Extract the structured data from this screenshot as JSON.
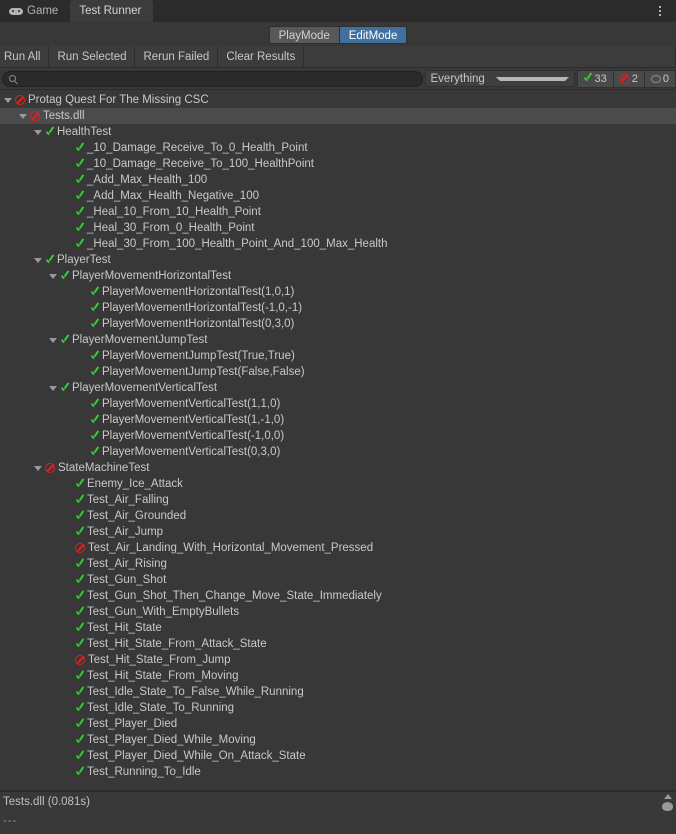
{
  "window": {
    "tabs": [
      {
        "label": "Game",
        "icon": "gamepad-icon",
        "active": false
      },
      {
        "label": "Test Runner",
        "icon": "",
        "active": true
      }
    ],
    "menu_icon": "kebab-menu-icon"
  },
  "modes": {
    "playmode_label": "PlayMode",
    "editmode_label": "EditMode",
    "selected": "EditMode"
  },
  "actions": [
    {
      "label": "Run All"
    },
    {
      "label": "Run Selected"
    },
    {
      "label": "Rerun Failed"
    },
    {
      "label": "Clear Results"
    }
  ],
  "filter": {
    "search_value": "",
    "search_placeholder": "",
    "search_icon": "search-icon",
    "dropdown_value": "Everything",
    "counts": {
      "passed": "33",
      "failed": "2",
      "notrun": "0"
    }
  },
  "status": {
    "line1": "Tests.dll (0.081s)",
    "line2": "---"
  },
  "colors": {
    "pass_green": "#37cc37",
    "fail_red": "#e02020",
    "selection_blue": "#41709e",
    "row_selected": "#4b4b4b",
    "background": "#383838"
  },
  "tree": [
    {
      "depth": 0,
      "status": "fail",
      "arrow": true,
      "selected": false,
      "label": "Protag Quest For The Missing CSC"
    },
    {
      "depth": 1,
      "status": "fail",
      "arrow": true,
      "selected": true,
      "label": "Tests.dll"
    },
    {
      "depth": 2,
      "status": "pass",
      "arrow": true,
      "selected": false,
      "label": "HealthTest"
    },
    {
      "depth": 4,
      "status": "pass",
      "arrow": false,
      "selected": false,
      "label": "_10_Damage_Receive_To_0_Health_Point"
    },
    {
      "depth": 4,
      "status": "pass",
      "arrow": false,
      "selected": false,
      "label": "_10_Damage_Receive_To_100_HealthPoint"
    },
    {
      "depth": 4,
      "status": "pass",
      "arrow": false,
      "selected": false,
      "label": "_Add_Max_Health_100"
    },
    {
      "depth": 4,
      "status": "pass",
      "arrow": false,
      "selected": false,
      "label": "_Add_Max_Health_Negative_100"
    },
    {
      "depth": 4,
      "status": "pass",
      "arrow": false,
      "selected": false,
      "label": "_Heal_10_From_10_Health_Point"
    },
    {
      "depth": 4,
      "status": "pass",
      "arrow": false,
      "selected": false,
      "label": "_Heal_30_From_0_Health_Point"
    },
    {
      "depth": 4,
      "status": "pass",
      "arrow": false,
      "selected": false,
      "label": "_Heal_30_From_100_Health_Point_And_100_Max_Health"
    },
    {
      "depth": 2,
      "status": "pass",
      "arrow": true,
      "selected": false,
      "label": "PlayerTest"
    },
    {
      "depth": 3,
      "status": "pass",
      "arrow": true,
      "selected": false,
      "label": "PlayerMovementHorizontalTest"
    },
    {
      "depth": 5,
      "status": "pass",
      "arrow": false,
      "selected": false,
      "label": "PlayerMovementHorizontalTest(1,0,1)"
    },
    {
      "depth": 5,
      "status": "pass",
      "arrow": false,
      "selected": false,
      "label": "PlayerMovementHorizontalTest(-1,0,-1)"
    },
    {
      "depth": 5,
      "status": "pass",
      "arrow": false,
      "selected": false,
      "label": "PlayerMovementHorizontalTest(0,3,0)"
    },
    {
      "depth": 3,
      "status": "pass",
      "arrow": true,
      "selected": false,
      "label": "PlayerMovementJumpTest"
    },
    {
      "depth": 5,
      "status": "pass",
      "arrow": false,
      "selected": false,
      "label": "PlayerMovementJumpTest(True,True)"
    },
    {
      "depth": 5,
      "status": "pass",
      "arrow": false,
      "selected": false,
      "label": "PlayerMovementJumpTest(False,False)"
    },
    {
      "depth": 3,
      "status": "pass",
      "arrow": true,
      "selected": false,
      "label": "PlayerMovementVerticalTest"
    },
    {
      "depth": 5,
      "status": "pass",
      "arrow": false,
      "selected": false,
      "label": "PlayerMovementVerticalTest(1,1,0)"
    },
    {
      "depth": 5,
      "status": "pass",
      "arrow": false,
      "selected": false,
      "label": "PlayerMovementVerticalTest(1,-1,0)"
    },
    {
      "depth": 5,
      "status": "pass",
      "arrow": false,
      "selected": false,
      "label": "PlayerMovementVerticalTest(-1,0,0)"
    },
    {
      "depth": 5,
      "status": "pass",
      "arrow": false,
      "selected": false,
      "label": "PlayerMovementVerticalTest(0,3,0)"
    },
    {
      "depth": 2,
      "status": "fail",
      "arrow": true,
      "selected": false,
      "label": "StateMachineTest"
    },
    {
      "depth": 4,
      "status": "pass",
      "arrow": false,
      "selected": false,
      "label": "Enemy_Ice_Attack"
    },
    {
      "depth": 4,
      "status": "pass",
      "arrow": false,
      "selected": false,
      "label": "Test_Air_Falling"
    },
    {
      "depth": 4,
      "status": "pass",
      "arrow": false,
      "selected": false,
      "label": "Test_Air_Grounded"
    },
    {
      "depth": 4,
      "status": "pass",
      "arrow": false,
      "selected": false,
      "label": "Test_Air_Jump"
    },
    {
      "depth": 4,
      "status": "fail",
      "arrow": false,
      "selected": false,
      "label": "Test_Air_Landing_With_Horizontal_Movement_Pressed"
    },
    {
      "depth": 4,
      "status": "pass",
      "arrow": false,
      "selected": false,
      "label": "Test_Air_Rising"
    },
    {
      "depth": 4,
      "status": "pass",
      "arrow": false,
      "selected": false,
      "label": "Test_Gun_Shot"
    },
    {
      "depth": 4,
      "status": "pass",
      "arrow": false,
      "selected": false,
      "label": "Test_Gun_Shot_Then_Change_Move_State_Immediately"
    },
    {
      "depth": 4,
      "status": "pass",
      "arrow": false,
      "selected": false,
      "label": "Test_Gun_With_EmptyBullets"
    },
    {
      "depth": 4,
      "status": "pass",
      "arrow": false,
      "selected": false,
      "label": "Test_Hit_State"
    },
    {
      "depth": 4,
      "status": "pass",
      "arrow": false,
      "selected": false,
      "label": "Test_Hit_State_From_Attack_State"
    },
    {
      "depth": 4,
      "status": "fail",
      "arrow": false,
      "selected": false,
      "label": "Test_Hit_State_From_Jump"
    },
    {
      "depth": 4,
      "status": "pass",
      "arrow": false,
      "selected": false,
      "label": "Test_Hit_State_From_Moving"
    },
    {
      "depth": 4,
      "status": "pass",
      "arrow": false,
      "selected": false,
      "label": "Test_Idle_State_To_False_While_Running"
    },
    {
      "depth": 4,
      "status": "pass",
      "arrow": false,
      "selected": false,
      "label": "Test_Idle_State_To_Running"
    },
    {
      "depth": 4,
      "status": "pass",
      "arrow": false,
      "selected": false,
      "label": "Test_Player_Died"
    },
    {
      "depth": 4,
      "status": "pass",
      "arrow": false,
      "selected": false,
      "label": "Test_Player_Died_While_Moving"
    },
    {
      "depth": 4,
      "status": "pass",
      "arrow": false,
      "selected": false,
      "label": "Test_Player_Died_While_On_Attack_State"
    },
    {
      "depth": 4,
      "status": "pass",
      "arrow": false,
      "selected": false,
      "label": "Test_Running_To_Idle"
    }
  ]
}
